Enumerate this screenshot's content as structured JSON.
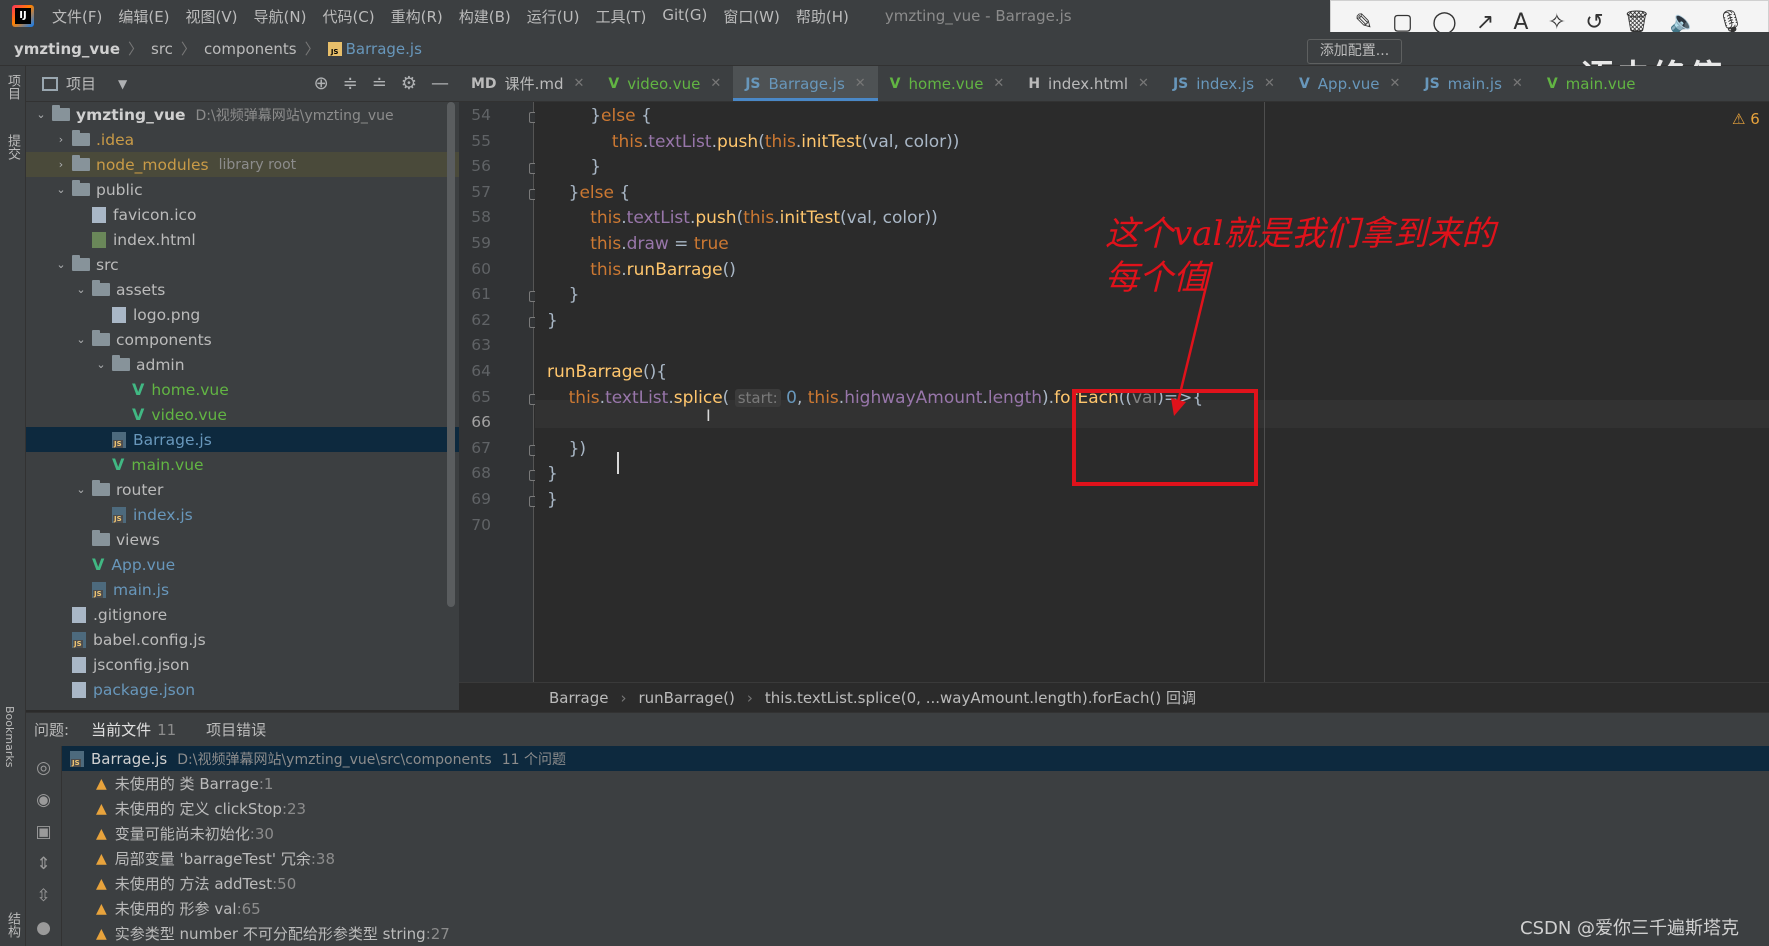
{
  "menubar": {
    "items": [
      "文件(F)",
      "编辑(E)",
      "视图(V)",
      "导航(N)",
      "代码(C)",
      "重构(R)",
      "构建(B)",
      "运行(U)",
      "工具(T)",
      "Git(G)",
      "窗口(W)",
      "帮助(H)"
    ],
    "title": "ymzting_vue - Barrage.js"
  },
  "annotation_toolbar": {
    "tools": [
      "pencil-icon",
      "rectangle-icon",
      "circle-icon",
      "arrow-icon",
      "text-icon",
      "magic-wand-icon",
      "undo-icon",
      "trash-icon",
      "speaker-icon",
      "microphone-icon"
    ],
    "glyphs": [
      "✎",
      "▢",
      "◯",
      "↗",
      "A",
      "✧",
      "↺",
      "🗑",
      "🔈",
      "🎙"
    ]
  },
  "navbar": {
    "project": "ymzting_vue",
    "crumb1": "src",
    "crumb2": "components",
    "file": "Barrage.js",
    "add_config": "添加配置...",
    "watermark": "语未终停"
  },
  "sidebar_strip": {
    "project_tab": "项目",
    "commit_tab": "提交",
    "bookmarks_tab": "Bookmarks",
    "structure_tab": "结构"
  },
  "project_panel": {
    "title": "项目"
  },
  "tree": [
    {
      "depth": 0,
      "arrow": "⌄",
      "type": "folder",
      "label": "ymzting_vue",
      "extra": "D:\\视频弹幕网站\\ymzting_vue",
      "bold": true
    },
    {
      "depth": 1,
      "arrow": "›",
      "type": "folder",
      "label": ".idea",
      "cls": "c-orange"
    },
    {
      "depth": 1,
      "arrow": "›",
      "type": "folder",
      "label": "node_modules",
      "extra": "library root",
      "cls": "c-orange",
      "lib": true
    },
    {
      "depth": 1,
      "arrow": "⌄",
      "type": "folder",
      "label": "public"
    },
    {
      "depth": 2,
      "arrow": "",
      "type": "gen",
      "label": "favicon.ico"
    },
    {
      "depth": 2,
      "arrow": "",
      "type": "html",
      "label": "index.html"
    },
    {
      "depth": 1,
      "arrow": "⌄",
      "type": "folder",
      "label": "src"
    },
    {
      "depth": 2,
      "arrow": "⌄",
      "type": "folder",
      "label": "assets"
    },
    {
      "depth": 3,
      "arrow": "",
      "type": "gen",
      "label": "logo.png"
    },
    {
      "depth": 2,
      "arrow": "⌄",
      "type": "folder",
      "label": "components"
    },
    {
      "depth": 3,
      "arrow": "⌄",
      "type": "folder",
      "label": "admin"
    },
    {
      "depth": 4,
      "arrow": "",
      "type": "vue",
      "label": "home.vue",
      "cls": "c-green"
    },
    {
      "depth": 4,
      "arrow": "",
      "type": "vue",
      "label": "video.vue",
      "cls": "c-green"
    },
    {
      "depth": 3,
      "arrow": "",
      "type": "js",
      "label": "Barrage.js",
      "cls": "c-blue",
      "sel": true
    },
    {
      "depth": 3,
      "arrow": "",
      "type": "vue",
      "label": "main.vue",
      "cls": "c-green"
    },
    {
      "depth": 2,
      "arrow": "⌄",
      "type": "folder",
      "label": "router"
    },
    {
      "depth": 3,
      "arrow": "",
      "type": "js",
      "label": "index.js",
      "cls": "c-blue"
    },
    {
      "depth": 2,
      "arrow": "",
      "type": "folder",
      "label": "views"
    },
    {
      "depth": 2,
      "arrow": "",
      "type": "vue",
      "label": "App.vue",
      "cls": "c-blue"
    },
    {
      "depth": 2,
      "arrow": "",
      "type": "js",
      "label": "main.js",
      "cls": "c-blue"
    },
    {
      "depth": 1,
      "arrow": "",
      "type": "gen",
      "label": ".gitignore"
    },
    {
      "depth": 1,
      "arrow": "",
      "type": "js",
      "label": "babel.config.js"
    },
    {
      "depth": 1,
      "arrow": "",
      "type": "gen",
      "label": "jsconfig.json"
    },
    {
      "depth": 1,
      "arrow": "",
      "type": "gen",
      "label": "package.json",
      "cls": "c-blue"
    }
  ],
  "tabs": [
    {
      "label": "课件.md",
      "icon": "MD",
      "color": "#bbbbbb"
    },
    {
      "label": "video.vue",
      "icon": "V",
      "color": "#62b543"
    },
    {
      "label": "Barrage.js",
      "icon": "JS",
      "color": "#6897bb",
      "active": true
    },
    {
      "label": "home.vue",
      "icon": "V",
      "color": "#62b543"
    },
    {
      "label": "index.html",
      "icon": "H",
      "color": "#bbbbbb"
    },
    {
      "label": "index.js",
      "icon": "JS",
      "color": "#6897bb"
    },
    {
      "label": "App.vue",
      "icon": "V",
      "color": "#6897bb"
    },
    {
      "label": "main.js",
      "icon": "JS",
      "color": "#6897bb"
    },
    {
      "label": "main.vue",
      "icon": "V",
      "color": "#62b543",
      "noclose": true
    }
  ],
  "line_numbers": [
    "54",
    "55",
    "56",
    "57",
    "58",
    "59",
    "60",
    "61",
    "62",
    "63",
    "64",
    "65",
    "66",
    "67",
    "68",
    "69",
    "70"
  ],
  "code": [
    [
      {
        "t": "        }",
        "c": "pl"
      },
      {
        "t": "else",
        "c": "kw"
      },
      {
        "t": " {",
        "c": "pl"
      }
    ],
    [
      {
        "t": "            ",
        "c": "pl"
      },
      {
        "t": "this",
        "c": "kw"
      },
      {
        "t": ".",
        "c": "pl"
      },
      {
        "t": "textList",
        "c": "fld"
      },
      {
        "t": ".",
        "c": "pl"
      },
      {
        "t": "push",
        "c": "fn"
      },
      {
        "t": "(",
        "c": "pl"
      },
      {
        "t": "this",
        "c": "kw"
      },
      {
        "t": ".",
        "c": "pl"
      },
      {
        "t": "initTest",
        "c": "fn"
      },
      {
        "t": "(val, color))",
        "c": "pl"
      }
    ],
    [
      {
        "t": "        }",
        "c": "pl"
      }
    ],
    [
      {
        "t": "    }",
        "c": "pl"
      },
      {
        "t": "else",
        "c": "kw"
      },
      {
        "t": " {",
        "c": "pl"
      }
    ],
    [
      {
        "t": "        ",
        "c": "pl"
      },
      {
        "t": "this",
        "c": "kw"
      },
      {
        "t": ".",
        "c": "pl"
      },
      {
        "t": "textList",
        "c": "fld"
      },
      {
        "t": ".",
        "c": "pl"
      },
      {
        "t": "push",
        "c": "fn"
      },
      {
        "t": "(",
        "c": "pl"
      },
      {
        "t": "this",
        "c": "kw"
      },
      {
        "t": ".",
        "c": "pl"
      },
      {
        "t": "initTest",
        "c": "fn"
      },
      {
        "t": "(val, color))",
        "c": "pl"
      }
    ],
    [
      {
        "t": "        ",
        "c": "pl"
      },
      {
        "t": "this",
        "c": "kw"
      },
      {
        "t": ".",
        "c": "pl"
      },
      {
        "t": "draw",
        "c": "fld"
      },
      {
        "t": " = ",
        "c": "pl"
      },
      {
        "t": "true",
        "c": "kw"
      }
    ],
    [
      {
        "t": "        ",
        "c": "pl"
      },
      {
        "t": "this",
        "c": "kw"
      },
      {
        "t": ".",
        "c": "pl"
      },
      {
        "t": "runBarrage",
        "c": "fn"
      },
      {
        "t": "()",
        "c": "pl"
      }
    ],
    [
      {
        "t": "    }",
        "c": "pl"
      }
    ],
    [
      {
        "t": "}",
        "c": "pl"
      }
    ],
    [],
    [
      {
        "t": "runBarrage",
        "c": "fn"
      },
      {
        "t": "(){",
        "c": "pl"
      }
    ],
    [
      {
        "t": "    ",
        "c": "pl"
      },
      {
        "t": "this",
        "c": "kw"
      },
      {
        "t": ".",
        "c": "pl"
      },
      {
        "t": "textList",
        "c": "fld"
      },
      {
        "t": ".",
        "c": "pl"
      },
      {
        "t": "splice",
        "c": "fn"
      },
      {
        "t": "( ",
        "c": "pl"
      },
      {
        "t": "start:",
        "c": "hint"
      },
      {
        "t": " ",
        "c": "pl"
      },
      {
        "t": "0",
        "c": "num"
      },
      {
        "t": ", ",
        "c": "pl"
      },
      {
        "t": "this",
        "c": "kw"
      },
      {
        "t": ".",
        "c": "pl"
      },
      {
        "t": "highwayAmount",
        "c": "fld"
      },
      {
        "t": ".",
        "c": "pl"
      },
      {
        "t": "length",
        "c": "fld"
      },
      {
        "t": ").",
        "c": "pl"
      },
      {
        "t": "forEach",
        "c": "fn"
      },
      {
        "t": "((",
        "c": "pl"
      },
      {
        "t": "val",
        "c": "gray"
      },
      {
        "t": ")=>{",
        "c": "pl"
      }
    ],
    [],
    [
      {
        "t": "    })",
        "c": "pl"
      }
    ],
    [
      {
        "t": "}",
        "c": "pl"
      }
    ],
    [
      {
        "t": "}",
        "c": "pl"
      }
    ],
    []
  ],
  "editor": {
    "warning_count": "⚠ 6"
  },
  "annotation": {
    "text_line1": "这个val就是我们拿到来的",
    "text_line2": "每个值"
  },
  "breadcrumb": {
    "items": [
      "Barrage",
      "runBarrage()",
      "this.textList.splice(0, ...wayAmount.length).forEach() 回调"
    ]
  },
  "problems": {
    "label": "问题:",
    "tabs": [
      {
        "label": "当前文件",
        "count": "11",
        "active": true
      },
      {
        "label": "项目错误",
        "count": ""
      }
    ],
    "header": {
      "file": "Barrage.js",
      "path": "D:\\视频弹幕网站\\ymzting_vue\\src\\components",
      "count": "11 个问题"
    },
    "items": [
      {
        "text": "未使用的 类 Barrage",
        "line": ":1"
      },
      {
        "text": "未使用的 定义 clickStop",
        "line": ":23"
      },
      {
        "text": "变量可能尚未初始化",
        "line": ":30"
      },
      {
        "text": "局部变量 'barrageTest' 冗余",
        "line": ":38"
      },
      {
        "text": "未使用的 方法 addTest",
        "line": ":50"
      },
      {
        "text": "未使用的 形参 val",
        "line": ":65"
      },
      {
        "text": "实参类型 number 不可分配给形参类型 string",
        "line": ":27"
      }
    ]
  },
  "footer": {
    "credit": "CSDN @爱你三千遍斯塔克"
  }
}
